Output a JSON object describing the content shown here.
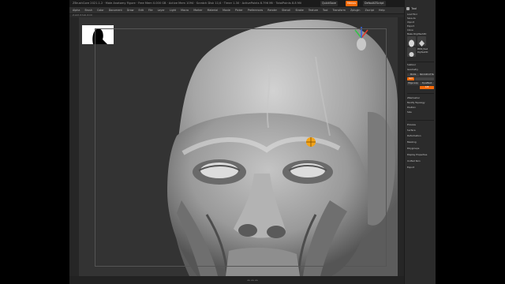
{
  "colors": {
    "accent": "#f36a0b",
    "cursor": "#f2a41a",
    "gizmo_x": "#e0392b",
    "gizmo_y": "#35c04a",
    "gizmo_z": "#3a63d8"
  },
  "window": {
    "title": "ZBrushCore 2021.1.2 · Male Anatomy Figure · Free Mem 0.000 GB · Active Mem 1094 · Scratch Disk 11/4 · Timer 1.30 · ActivePoints 8.796 Mil · TotalPoints 8.8 Mil",
    "buttons": [
      "QuickSave",
      "Menus",
      "DefaultZScript"
    ]
  },
  "menubar": {
    "items": [
      "Alpha",
      "Brush",
      "Color",
      "Document",
      "Draw",
      "Edit",
      "File",
      "Layer",
      "Light",
      "Macro",
      "Marker",
      "Material",
      "Movie",
      "Picker",
      "Preferences",
      "Render",
      "Stencil",
      "Stroke",
      "Texture",
      "Tool",
      "Transform",
      "Zplugin",
      "Zscript",
      "Help"
    ]
  },
  "status": {
    "text": "Z-Add Z-Sub Z-Int"
  },
  "bottombar": {
    "text": "◂ ▸ ◂ ▸ ◂ ▸"
  },
  "tool_panel": {
    "title": "Tool",
    "rows": [
      "Load Tool",
      "Save As",
      "Import",
      "Export",
      "Clone",
      "Make PolyMesh3D"
    ],
    "tool_label": "PM3D_Head",
    "subtool_label": "PolyMesh3D",
    "sections_top": [
      "Subtool",
      "Geometry"
    ],
    "divide_button": "Divide",
    "reconstruct_button": "Reconstruct Subdiv",
    "smt_label": "Smt",
    "edge_loop": "Edge Loop",
    "dynamesh": "DynaMesh",
    "resolution": "128",
    "sections_mid": [
      "ZRemesher",
      "Modify Topology",
      "Position",
      "Size"
    ],
    "sections_bottom": [
      "Preview",
      "Surface",
      "Deformation",
      "Masking",
      "Polygroups",
      "Display Properties",
      "Unified Skin",
      "Export"
    ]
  }
}
